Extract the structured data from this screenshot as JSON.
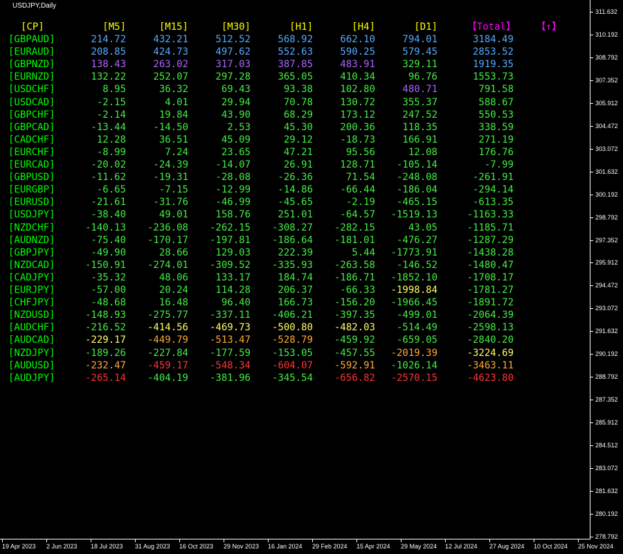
{
  "symbol_label": "USDJPY,Daily",
  "colors": {
    "background": "#000000",
    "header_timeframe": "#ffff00",
    "header_total": "#ff00ff",
    "pair": "#00ff00",
    "level_blue": "#55aaff",
    "level_purple": "#aa66ff",
    "level_green": "#44ee44",
    "level_yellow": "#ffff66",
    "level_orange": "#ffaa33",
    "level_red": "#ff3333",
    "axis": "#ffffff"
  },
  "table": {
    "headers": [
      "[CP]",
      "[M5]",
      "[M15]",
      "[M30]",
      "[H1]",
      "[H4]",
      "[D1]",
      "【Total】",
      "【↑】"
    ],
    "rows": [
      {
        "pair": "[GBPAUD]",
        "values": [
          "214.72",
          "432.21",
          "512.52",
          "568.92",
          "662.10",
          "794.01",
          "3184.49"
        ],
        "levels": [
          "blue",
          "blue",
          "blue",
          "blue",
          "blue",
          "blue",
          "blue"
        ]
      },
      {
        "pair": "[EURAUD]",
        "values": [
          "208.85",
          "424.73",
          "497.62",
          "552.63",
          "590.25",
          "579.45",
          "2853.52"
        ],
        "levels": [
          "blue",
          "blue",
          "blue",
          "blue",
          "blue",
          "blue",
          "blue"
        ]
      },
      {
        "pair": "[GBPNZD]",
        "values": [
          "138.43",
          "263.02",
          "317.03",
          "387.85",
          "483.91",
          "329.11",
          "1919.35"
        ],
        "levels": [
          "purple",
          "purple",
          "purple",
          "purple",
          "purple",
          "green",
          "blue"
        ]
      },
      {
        "pair": "[EURNZD]",
        "values": [
          "132.22",
          "252.07",
          "297.28",
          "365.05",
          "410.34",
          "96.76",
          "1553.73"
        ],
        "levels": [
          "green",
          "green",
          "green",
          "green",
          "green",
          "green",
          "green"
        ]
      },
      {
        "pair": "[USDCHF]",
        "values": [
          "8.95",
          "36.32",
          "69.43",
          "93.38",
          "102.80",
          "480.71",
          "791.58"
        ],
        "levels": [
          "green",
          "green",
          "green",
          "green",
          "green",
          "purple",
          "green"
        ]
      },
      {
        "pair": "[USDCAD]",
        "values": [
          "-2.15",
          "4.01",
          "29.94",
          "70.78",
          "130.72",
          "355.37",
          "588.67"
        ],
        "levels": [
          "green",
          "green",
          "green",
          "green",
          "green",
          "green",
          "green"
        ]
      },
      {
        "pair": "[GBPCHF]",
        "values": [
          "-2.14",
          "19.84",
          "43.90",
          "68.29",
          "173.12",
          "247.52",
          "550.53"
        ],
        "levels": [
          "green",
          "green",
          "green",
          "green",
          "green",
          "green",
          "green"
        ]
      },
      {
        "pair": "[GBPCAD]",
        "values": [
          "-13.44",
          "-14.50",
          "2.53",
          "45.30",
          "200.36",
          "118.35",
          "338.59"
        ],
        "levels": [
          "green",
          "green",
          "green",
          "green",
          "green",
          "green",
          "green"
        ]
      },
      {
        "pair": "[CADCHF]",
        "values": [
          "12.28",
          "36.51",
          "45.09",
          "29.12",
          "-18.73",
          "166.91",
          "271.19"
        ],
        "levels": [
          "green",
          "green",
          "green",
          "green",
          "green",
          "green",
          "green"
        ]
      },
      {
        "pair": "[EURCHF]",
        "values": [
          "-8.99",
          "7.24",
          "23.65",
          "47.21",
          "95.56",
          "12.08",
          "176.76"
        ],
        "levels": [
          "green",
          "green",
          "green",
          "green",
          "green",
          "green",
          "green"
        ]
      },
      {
        "pair": "[EURCAD]",
        "values": [
          "-20.02",
          "-24.39",
          "-14.07",
          "26.91",
          "128.71",
          "-105.14",
          "-7.99"
        ],
        "levels": [
          "green",
          "green",
          "green",
          "green",
          "green",
          "green",
          "green"
        ]
      },
      {
        "pair": "[GBPUSD]",
        "values": [
          "-11.62",
          "-19.31",
          "-28.08",
          "-26.36",
          "71.54",
          "-248.08",
          "-261.91"
        ],
        "levels": [
          "green",
          "green",
          "green",
          "green",
          "green",
          "green",
          "green"
        ]
      },
      {
        "pair": "[EURGBP]",
        "values": [
          "-6.65",
          "-7.15",
          "-12.99",
          "-14.86",
          "-66.44",
          "-186.04",
          "-294.14"
        ],
        "levels": [
          "green",
          "green",
          "green",
          "green",
          "green",
          "green",
          "green"
        ]
      },
      {
        "pair": "[EURUSD]",
        "values": [
          "-21.61",
          "-31.76",
          "-46.99",
          "-45.65",
          "-2.19",
          "-465.15",
          "-613.35"
        ],
        "levels": [
          "green",
          "green",
          "green",
          "green",
          "green",
          "green",
          "green"
        ]
      },
      {
        "pair": "[USDJPY]",
        "values": [
          "-38.40",
          "49.01",
          "158.76",
          "251.01",
          "-64.57",
          "-1519.13",
          "-1163.33"
        ],
        "levels": [
          "green",
          "green",
          "green",
          "green",
          "green",
          "green",
          "green"
        ]
      },
      {
        "pair": "[NZDCHF]",
        "values": [
          "-140.13",
          "-236.08",
          "-262.15",
          "-308.27",
          "-282.15",
          "43.05",
          "-1185.71"
        ],
        "levels": [
          "green",
          "green",
          "green",
          "green",
          "green",
          "green",
          "green"
        ]
      },
      {
        "pair": "[AUDNZD]",
        "values": [
          "-75.40",
          "-170.17",
          "-197.81",
          "-186.64",
          "-181.01",
          "-476.27",
          "-1287.29"
        ],
        "levels": [
          "green",
          "green",
          "green",
          "green",
          "green",
          "green",
          "green"
        ]
      },
      {
        "pair": "[GBPJPY]",
        "values": [
          "-49.90",
          "28.66",
          "129.03",
          "222.39",
          "5.44",
          "-1773.91",
          "-1438.28"
        ],
        "levels": [
          "green",
          "green",
          "green",
          "green",
          "green",
          "green",
          "green"
        ]
      },
      {
        "pair": "[NZDCAD]",
        "values": [
          "-150.91",
          "-274.01",
          "-309.52",
          "-335.93",
          "-263.58",
          "-146.52",
          "-1480.47"
        ],
        "levels": [
          "green",
          "green",
          "green",
          "green",
          "green",
          "green",
          "green"
        ]
      },
      {
        "pair": "[CADJPY]",
        "values": [
          "-35.32",
          "48.06",
          "133.17",
          "184.74",
          "-186.71",
          "-1852.10",
          "-1708.17"
        ],
        "levels": [
          "green",
          "green",
          "green",
          "green",
          "green",
          "green",
          "green"
        ]
      },
      {
        "pair": "[EURJPY]",
        "values": [
          "-57.00",
          "20.24",
          "114.28",
          "206.37",
          "-66.33",
          "-1998.84",
          "-1781.27"
        ],
        "levels": [
          "green",
          "green",
          "green",
          "green",
          "green",
          "yellow",
          "green"
        ]
      },
      {
        "pair": "[CHFJPY]",
        "values": [
          "-48.68",
          "16.48",
          "96.40",
          "166.73",
          "-156.20",
          "-1966.45",
          "-1891.72"
        ],
        "levels": [
          "green",
          "green",
          "green",
          "green",
          "green",
          "green",
          "green"
        ]
      },
      {
        "pair": "[NZDUSD]",
        "values": [
          "-148.93",
          "-275.77",
          "-337.11",
          "-406.21",
          "-397.35",
          "-499.01",
          "-2064.39"
        ],
        "levels": [
          "green",
          "green",
          "green",
          "green",
          "green",
          "green",
          "green"
        ]
      },
      {
        "pair": "[AUDCHF]",
        "values": [
          "-216.52",
          "-414.56",
          "-469.73",
          "-500.80",
          "-482.03",
          "-514.49",
          "-2598.13"
        ],
        "levels": [
          "green",
          "yellow",
          "yellow",
          "yellow",
          "yellow",
          "green",
          "green"
        ]
      },
      {
        "pair": "[AUDCAD]",
        "values": [
          "-229.17",
          "-449.79",
          "-513.47",
          "-528.79",
          "-459.92",
          "-659.05",
          "-2840.20"
        ],
        "levels": [
          "yellow",
          "orange",
          "orange",
          "orange",
          "green",
          "green",
          "green"
        ]
      },
      {
        "pair": "[NZDJPY]",
        "values": [
          "-189.26",
          "-227.84",
          "-177.59",
          "-153.05",
          "-457.55",
          "-2019.39",
          "-3224.69"
        ],
        "levels": [
          "green",
          "green",
          "green",
          "green",
          "green",
          "orange",
          "yellow"
        ]
      },
      {
        "pair": "[AUDUSD]",
        "values": [
          "-232.47",
          "-459.17",
          "-548.34",
          "-604.07",
          "-592.91",
          "-1026.14",
          "-3463.11"
        ],
        "levels": [
          "orange",
          "red",
          "red",
          "red",
          "orange",
          "green",
          "orange"
        ]
      },
      {
        "pair": "[AUDJPY]",
        "values": [
          "-265.14",
          "-404.19",
          "-381.96",
          "-345.54",
          "-656.82",
          "-2570.15",
          "-4623.80"
        ],
        "levels": [
          "red",
          "green",
          "green",
          "green",
          "red",
          "red",
          "red"
        ]
      }
    ]
  },
  "price_axis": [
    "311.632",
    "310.192",
    "308.792",
    "307.352",
    "305.912",
    "304.472",
    "303.072",
    "301.632",
    "300.192",
    "298.792",
    "297.352",
    "295.912",
    "294.472",
    "293.072",
    "291.632",
    "290.192",
    "288.792",
    "287.352",
    "285.912",
    "284.512",
    "283.072",
    "281.632",
    "280.192",
    "278.792"
  ],
  "time_axis": [
    "19 Apr 2023",
    "2 Jun 2023",
    "18 Jul 2023",
    "31 Aug 2023",
    "16 Oct 2023",
    "29 Nov 2023",
    "16 Jan 2024",
    "29 Feb 2024",
    "15 Apr 2024",
    "29 May 2024",
    "12 Jul 2024",
    "27 Aug 2024",
    "10 Oct 2024",
    "25 Nov 2024"
  ]
}
